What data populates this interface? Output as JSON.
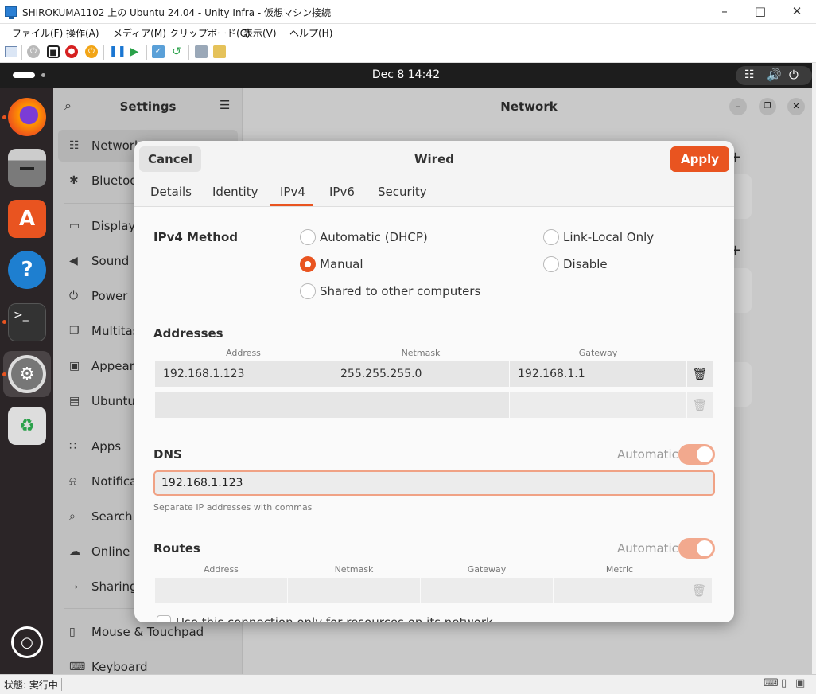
{
  "host": {
    "title": "SHIROKUMA1102 上の Ubuntu 24.04 - Unity Infra - 仮想マシン接続",
    "menu": [
      "ファイル(F)",
      "操作(A)",
      "メディア(M)",
      "クリップボード(C)",
      "表示(V)",
      "ヘルプ(H)"
    ],
    "status": "状態: 実行中"
  },
  "topbar": {
    "clock": "Dec 8  14:42"
  },
  "settings": {
    "title": "Settings",
    "page_title": "Network",
    "items": [
      {
        "label": "Network",
        "icon": "network-icon"
      },
      {
        "label": "Bluetooth",
        "icon": "bluetooth-icon"
      },
      {
        "label": "Displays",
        "icon": "display-icon"
      },
      {
        "label": "Sound",
        "icon": "sound-icon"
      },
      {
        "label": "Power",
        "icon": "power-icon"
      },
      {
        "label": "Multitasking",
        "icon": "multitasking-icon"
      },
      {
        "label": "Appearance",
        "icon": "appearance-icon"
      },
      {
        "label": "Ubuntu Desktop",
        "icon": "ubuntu-desktop-icon"
      },
      {
        "label": "Apps",
        "icon": "apps-icon"
      },
      {
        "label": "Notifications",
        "icon": "bell-icon"
      },
      {
        "label": "Search",
        "icon": "search-icon"
      },
      {
        "label": "Online Accounts",
        "icon": "cloud-icon"
      },
      {
        "label": "Sharing",
        "icon": "share-icon"
      },
      {
        "label": "Mouse & Touchpad",
        "icon": "mouse-icon"
      },
      {
        "label": "Keyboard",
        "icon": "keyboard-icon"
      }
    ]
  },
  "dialog": {
    "title": "Wired",
    "cancel": "Cancel",
    "apply": "Apply",
    "tabs": [
      "Details",
      "Identity",
      "IPv4",
      "IPv6",
      "Security"
    ],
    "active_tab": "IPv4",
    "method_label": "IPv4 Method",
    "methods": {
      "dhcp": "Automatic (DHCP)",
      "link_local": "Link-Local Only",
      "manual": "Manual",
      "disable": "Disable",
      "shared": "Shared to other computers"
    },
    "selected_method": "Manual",
    "addresses": {
      "label": "Addresses",
      "headers": [
        "Address",
        "Netmask",
        "Gateway"
      ],
      "rows": [
        [
          "192.168.1.123",
          "255.255.255.0",
          "192.168.1.1"
        ],
        [
          "",
          "",
          ""
        ]
      ]
    },
    "dns": {
      "label": "DNS",
      "automatic_label": "Automatic",
      "automatic": true,
      "value": "192.168.1.123",
      "hint": "Separate IP addresses with commas"
    },
    "routes": {
      "label": "Routes",
      "automatic_label": "Automatic",
      "automatic": true,
      "headers": [
        "Address",
        "Netmask",
        "Gateway",
        "Metric"
      ],
      "rows": [
        [
          "",
          "",
          "",
          ""
        ]
      ],
      "only_resources": "Use this connection only for resources on its network"
    }
  },
  "colors": {
    "accent": "#e95420",
    "toggle": "#f2a98e"
  }
}
